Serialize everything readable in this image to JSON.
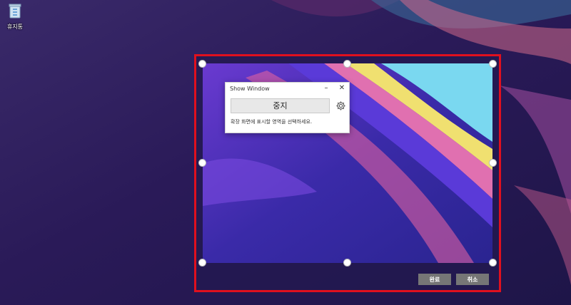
{
  "desktop": {
    "recycle_bin_label": "휴지통",
    "recycle_bin_icon": "recycle-bin-icon"
  },
  "dialog": {
    "title": "Show Window",
    "minimize_symbol": "–",
    "close_symbol": "✕",
    "stop_label": "중지",
    "message": "확장 화면에 표시할 영역을 선택하세요."
  },
  "actions": {
    "done_label": "완료",
    "cancel_label": "취소"
  },
  "colors": {
    "selection_border": "#e0101e",
    "button_gray": "#767676"
  }
}
